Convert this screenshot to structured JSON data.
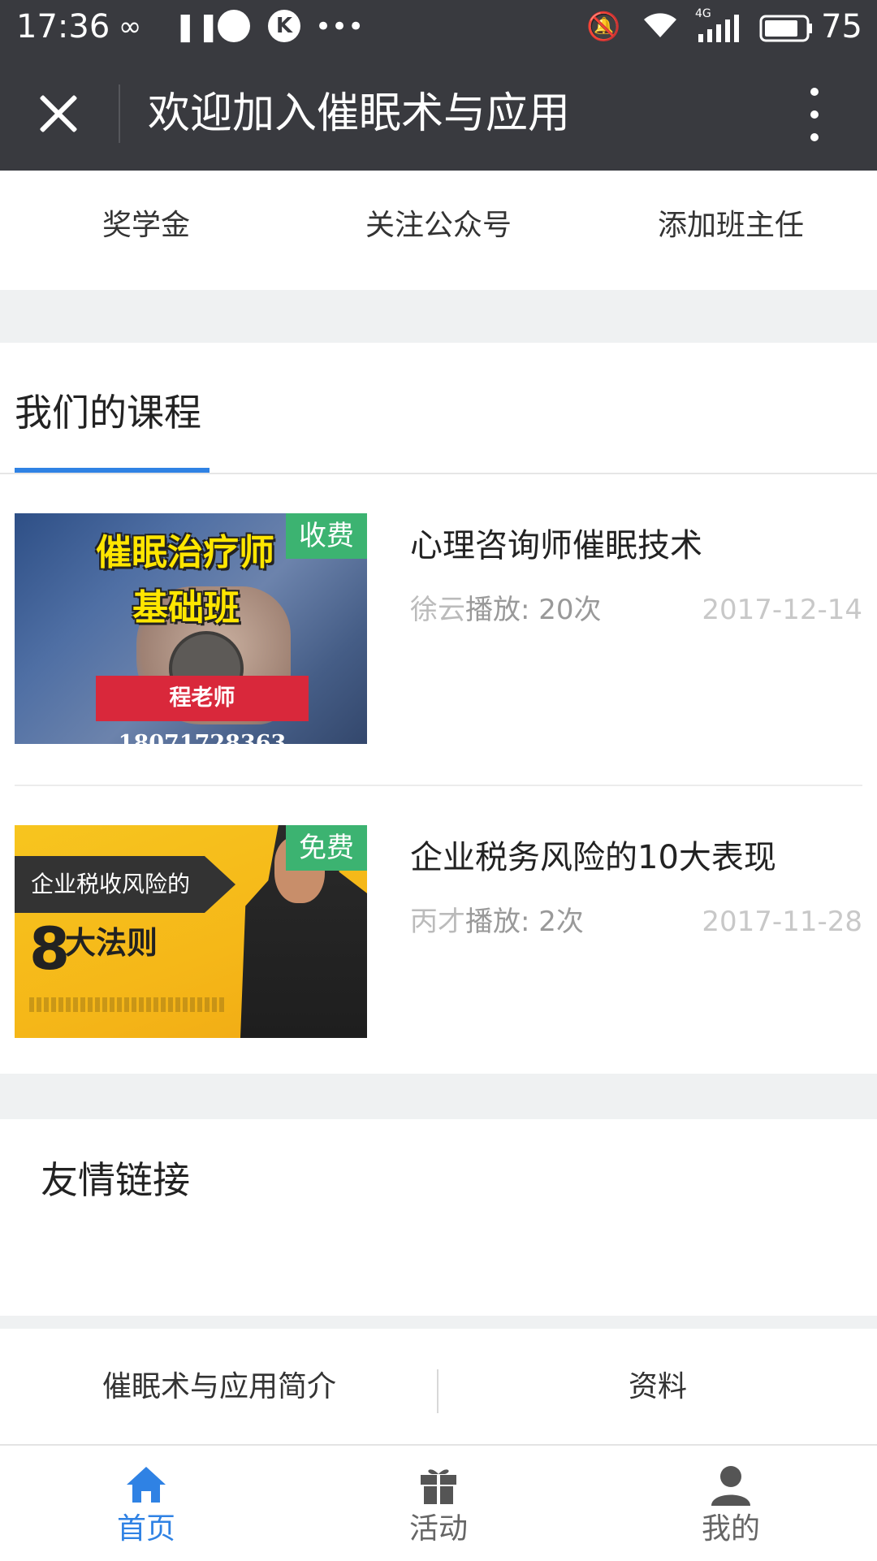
{
  "status_bar": {
    "time": "17:36",
    "battery": "75",
    "network": "4G"
  },
  "header": {
    "title": "欢迎加入催眠术与应用"
  },
  "quick_links": [
    {
      "label": "奖学金"
    },
    {
      "label": "关注公众号"
    },
    {
      "label": "添加班主任"
    }
  ],
  "courses_section": {
    "title": "我们的课程"
  },
  "courses": [
    {
      "title": "心理咨询师催眠技术",
      "author": "徐云",
      "plays": "播放: 20次",
      "date": "2017-12-14",
      "badge": "收费",
      "thumb_line1": "催眠治疗师",
      "thumb_line2": "基础班",
      "thumb_phone": "程老师18071728363"
    },
    {
      "title": "企业税务风险的10大表现",
      "author": "丙才",
      "plays": "播放: 2次",
      "date": "2017-11-28",
      "badge": "免费",
      "thumb_band": "企业税收风险的",
      "thumb_big": "8",
      "thumb_rule": "大法则"
    }
  ],
  "friend_links": {
    "title": "友情链接"
  },
  "bottom_menu": [
    {
      "label": "催眠术与应用简介"
    },
    {
      "label": "资料"
    }
  ],
  "tab_bar": [
    {
      "label": "首页",
      "icon": "home-icon",
      "active": true
    },
    {
      "label": "活动",
      "icon": "gift-icon",
      "active": false
    },
    {
      "label": "我的",
      "icon": "user-icon",
      "active": false
    }
  ],
  "colors": {
    "header_bg": "#393a3f",
    "accent": "#2f82e4",
    "badge_green": "#3cb371",
    "separator": "#eff1f2"
  }
}
